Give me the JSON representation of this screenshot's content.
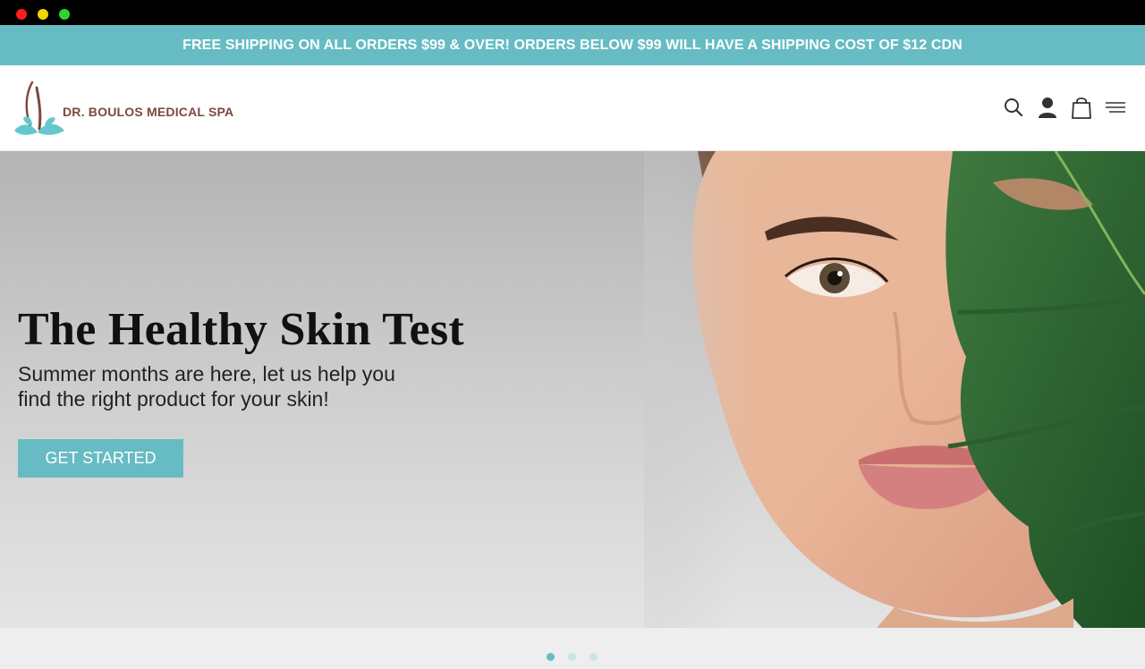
{
  "announcement": {
    "text": "FREE SHIPPING ON ALL ORDERS $99 & OVER! ORDERS BELOW $99 WILL HAVE A SHIPPING COST OF $12 CDN"
  },
  "header": {
    "brand": "DR. BOULOS MEDICAL SPA",
    "icons": [
      "search-icon",
      "account-icon",
      "cart-icon",
      "menu-icon"
    ]
  },
  "hero": {
    "title": "The Healthy Skin Test",
    "subtitle_line1": "Summer months are here, let us help you",
    "subtitle_line2": "find the right product for your skin!",
    "cta_label": "GET STARTED"
  },
  "carousel": {
    "slide_count": 3,
    "active_index": 0
  },
  "colors": {
    "accent": "#66bcc2",
    "brand_text": "#7a4a3e",
    "chrome": "#000000"
  }
}
